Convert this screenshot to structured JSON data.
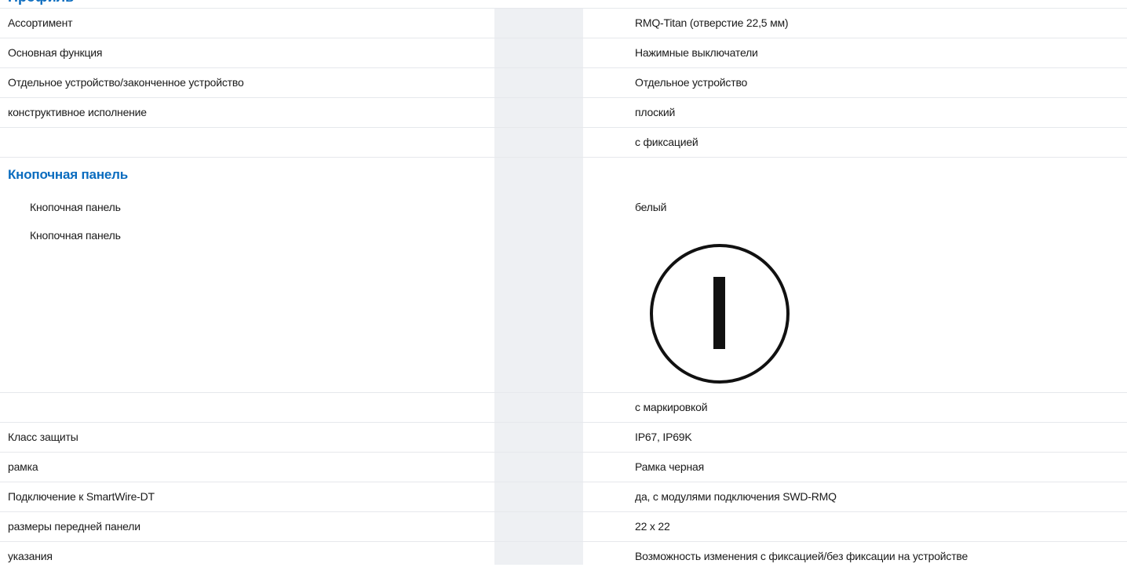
{
  "top_heading": "Профиль",
  "rows_before": [
    {
      "label": "Ассортимент",
      "value": "RMQ-Titan (отверстие 22,5 мм)"
    },
    {
      "label": "Основная функция",
      "value": "Нажимные выключатели"
    },
    {
      "label": "Отдельное устройство/законченное устройство",
      "value": "Отдельное устройство"
    },
    {
      "label": "конструктивное исполнение",
      "value": "плоский"
    },
    {
      "label": "",
      "value": "с фиксацией"
    }
  ],
  "section": {
    "heading": "Кнопочная панель",
    "color_row": {
      "label": "Кнопочная панель",
      "value": "белый"
    },
    "symbol_row": {
      "label": "Кнопочная панель",
      "symbol": "power-on-I-icon"
    }
  },
  "rows_after": [
    {
      "label": "",
      "value": "с маркировкой"
    },
    {
      "label": "Класс защиты",
      "value": "IP67, IP69K"
    },
    {
      "label": "рамка",
      "value": "Рамка черная"
    },
    {
      "label": "Подключение к SmartWire-DT",
      "value": "да, с модулями подключения SWD-RMQ"
    },
    {
      "label": "размеры передней панели",
      "value": "22 x 22"
    },
    {
      "label": "указания",
      "value": "Возможность изменения с фиксацией/без фиксации на устройстве"
    }
  ],
  "colors": {
    "heading_blue": "#0a6cbf",
    "grey_column": "#eef0f3",
    "row_divider": "#e6e8ec"
  }
}
